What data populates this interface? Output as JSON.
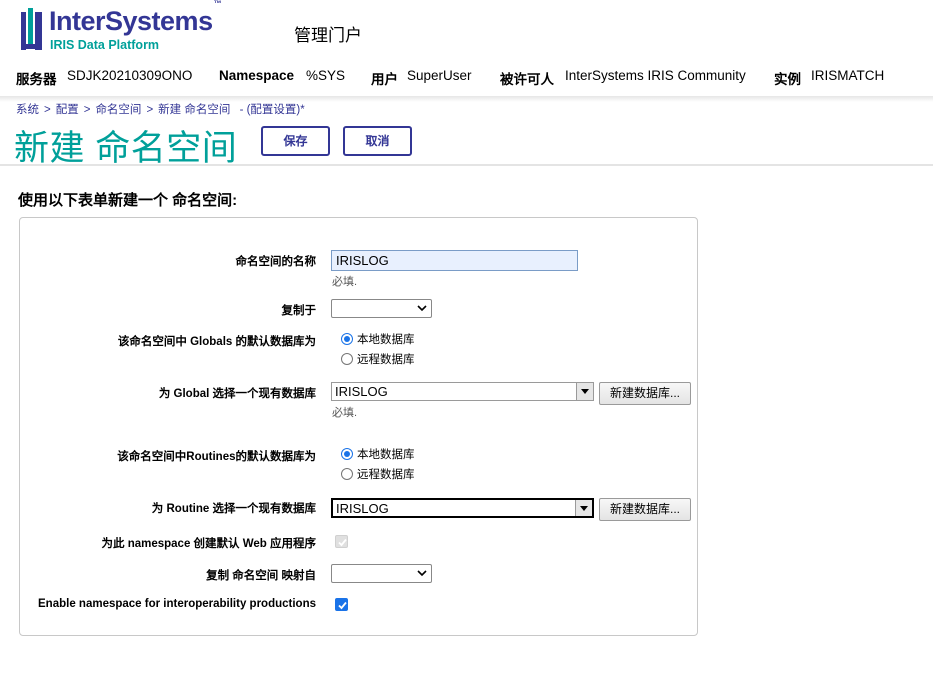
{
  "header": {
    "brand": "InterSystems",
    "brand_tm": "™",
    "brand_sub": "IRIS Data Platform",
    "portal_title": "管理门户",
    "info": [
      {
        "key": "服务器",
        "value": "SDJK20210309ONO"
      },
      {
        "key": "Namespace",
        "value": "%SYS"
      },
      {
        "key": "用户",
        "value": "SuperUser"
      },
      {
        "key": "被许可人",
        "value": "InterSystems IRIS Community"
      },
      {
        "key": "实例",
        "value": "IRISMATCH"
      }
    ]
  },
  "breadcrumb": {
    "items": [
      "系统",
      "配置",
      "命名空间",
      "新建 命名空间"
    ],
    "separator": ">",
    "suffix": "- (配置设置)*"
  },
  "page": {
    "title": "新建 命名空间",
    "save_label": "保存",
    "cancel_label": "取消",
    "intro": "使用以下表单新建一个 命名空间:"
  },
  "form": {
    "name_label": "命名空间的名称",
    "name_value": "IRISLOG",
    "required_hint": "必填.",
    "copy_from_label": "复制于",
    "copy_from_value": "",
    "globals_db_label": "该命名空间中 Globals 的默认数据库为",
    "globals_options": [
      "本地数据库",
      "远程数据库"
    ],
    "globals_selected": 0,
    "global_db_label": "为 Global 选择一个现有数据库",
    "global_db_value": "IRISLOG",
    "global_required_hint": "必填.",
    "new_db_label": "新建数据库...",
    "routines_db_label": "该命名空间中Routines的默认数据库为",
    "routines_options": [
      "本地数据库",
      "远程数据库"
    ],
    "routines_selected": 0,
    "routine_db_label": "为 Routine 选择一个现有数据库",
    "routine_db_value": "IRISLOG",
    "web_app_label": "为此 namespace 创建默认 Web 应用程序",
    "web_app_checked": true,
    "web_app_disabled": true,
    "copy_mappings_label": "复制 命名空间 映射自",
    "copy_mappings_value": "",
    "interop_label": "Enable namespace for interoperability productions",
    "interop_checked": true
  },
  "colors": {
    "brand_navy": "#333695",
    "brand_teal": "#00a09a",
    "check_blue": "#1a73e8"
  }
}
